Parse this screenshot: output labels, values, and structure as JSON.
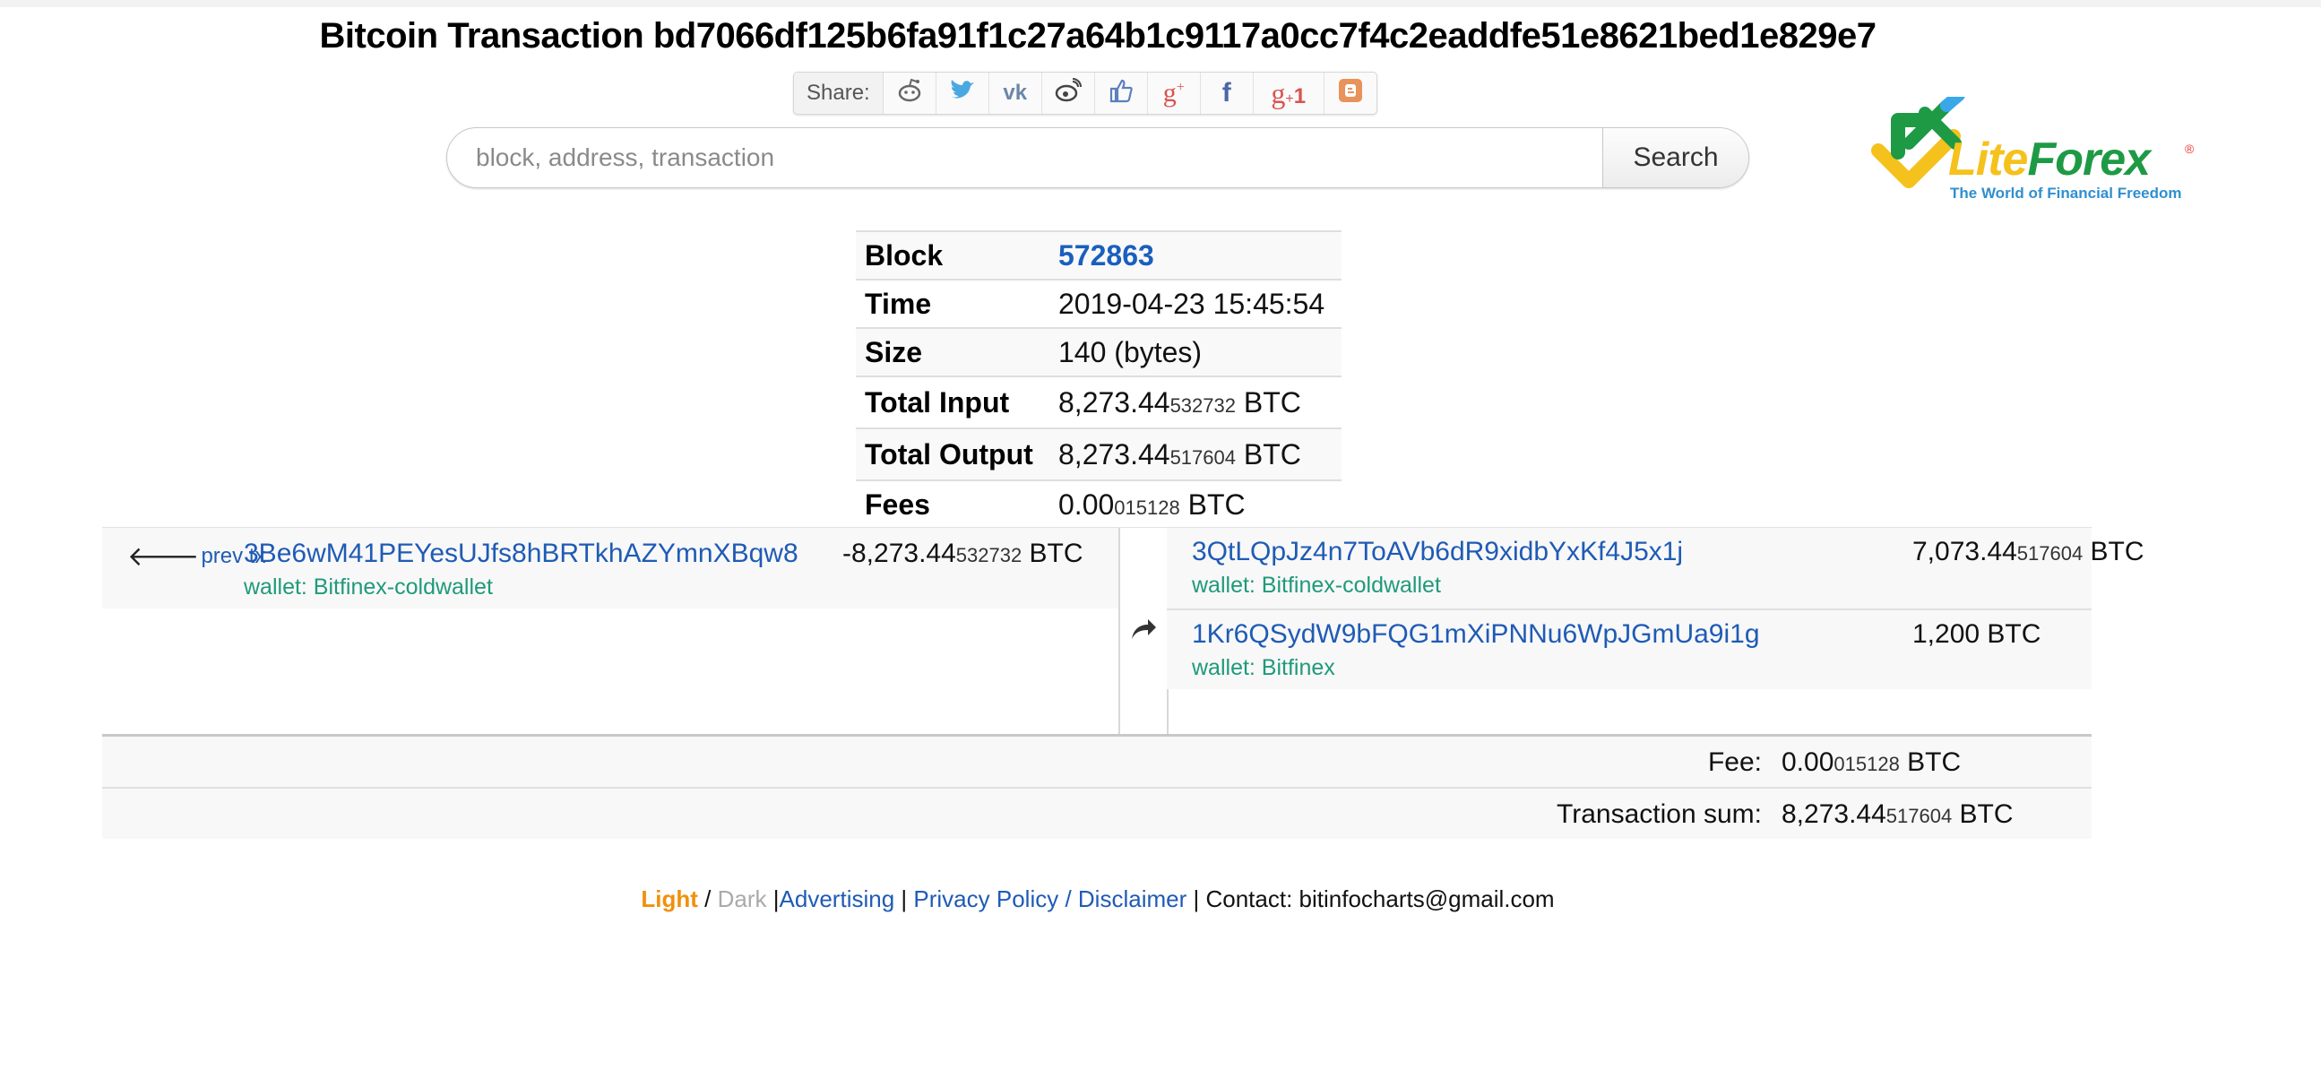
{
  "page": {
    "title": "Bitcoin Transaction bd7066df125b6fa91f1c27a64b1c9117a0cc7f4c2eaddfe51e8621bed1e829e7"
  },
  "share": {
    "label": "Share:",
    "buttons": [
      {
        "name": "reddit",
        "glyph": "☺",
        "color": "#666666"
      },
      {
        "name": "twitter",
        "glyph": "🐦",
        "color": "#4aa8e0"
      },
      {
        "name": "vk",
        "glyph": "vk",
        "color": "#6b87a8"
      },
      {
        "name": "weibo",
        "glyph": "◎",
        "color": "#444444"
      },
      {
        "name": "like",
        "glyph": "👍",
        "color": "#5c7fc0"
      },
      {
        "name": "google-plus",
        "glyph": "g+",
        "color": "#d9534f"
      },
      {
        "name": "facebook",
        "glyph": "f",
        "color": "#4a68a8"
      },
      {
        "name": "google-plus-one",
        "glyph": "g+1",
        "color": "#d9534f"
      },
      {
        "name": "blogger",
        "glyph": "B",
        "color": "#e8935c"
      }
    ]
  },
  "search": {
    "placeholder": "block, address, transaction",
    "value": "",
    "button_label": "Search"
  },
  "logo": {
    "word_lite": "Lite",
    "word_forex": "Forex",
    "registered": "®",
    "tagline": "The World of Financial Freedom",
    "colors": {
      "yellow": "#f5c11c",
      "green": "#1e9a45",
      "blue": "#2f8fd0"
    }
  },
  "info": {
    "block_label": "Block",
    "block_value": "572863",
    "time_label": "Time",
    "time_value": "2019-04-23 15:45:54",
    "size_label": "Size",
    "size_value": "140 (bytes)",
    "total_input_label": "Total Input",
    "total_input_main": "8,273.44",
    "total_input_small": "532732",
    "total_output_label": "Total Output",
    "total_output_main": "8,273.44",
    "total_output_small": "517604",
    "fees_label": "Fees",
    "fees_main": "0.00",
    "fees_small": "015128",
    "unit": "BTC"
  },
  "inputs": [
    {
      "prev_tx_label": "prev tx",
      "address": "3Be6wM41PEYesUJfs8hBRTkhAZYmnXBqw8",
      "wallet": "wallet: Bitfinex-coldwallet",
      "amount_main": "-8,273.44",
      "amount_small": "532732",
      "unit": "BTC"
    }
  ],
  "outputs": [
    {
      "address": "3QtLQpJz4n7ToAVb6dR9xidbYxKf4J5x1j",
      "wallet": "wallet: Bitfinex-coldwallet",
      "amount_main": "7,073.44",
      "amount_small": "517604",
      "unit": "BTC"
    },
    {
      "address": "1Kr6QSydW9bFQG1mXiPNNu6WpJGmUa9i1g",
      "wallet": "wallet: Bitfinex",
      "amount_main": "1,200",
      "amount_small": "",
      "unit": "BTC"
    }
  ],
  "summary": {
    "fee_label": "Fee:",
    "fee_main": "0.00",
    "fee_small": "015128",
    "sum_label": "Transaction sum:",
    "sum_main": "8,273.44",
    "sum_small": "517604",
    "unit": "BTC"
  },
  "footer": {
    "light": "Light",
    "slash": "/",
    "dark": "Dark",
    "sep": "|",
    "advertising": "Advertising",
    "privacy": "Privacy Policy",
    "disclaimer": "Disclaimer",
    "contact": "Contact: bitinfocharts@gmail.com"
  }
}
